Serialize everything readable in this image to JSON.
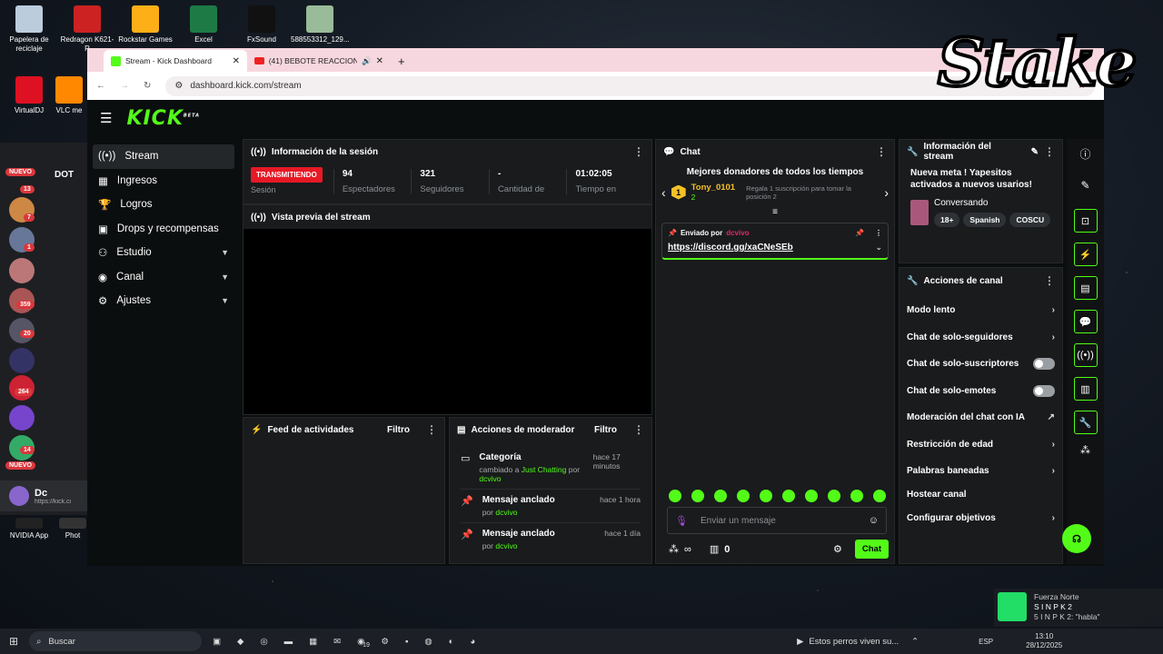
{
  "desktop": {
    "icons": [
      {
        "label": "Papelera de reciclaje"
      },
      {
        "label": "Redragon K621-R"
      },
      {
        "label": "Rockstar Games"
      },
      {
        "label": "Excel"
      },
      {
        "label": "FxSound"
      },
      {
        "label": "588553312_129..."
      },
      {
        "label": "VirtualDJ"
      },
      {
        "label": "VLC me"
      },
      {
        "label": "NVIDIA App"
      },
      {
        "label": "Phot"
      }
    ]
  },
  "overlay": {
    "stake_text": "Stake"
  },
  "browser": {
    "tabs": [
      {
        "title": "Stream - Kick Dashboard",
        "close": "✕"
      },
      {
        "title": "(41) BEBOTE REACCIONA A",
        "close": "✕"
      }
    ],
    "new_tab": "+",
    "url": "dashboard.kick.com/stream"
  },
  "kick": {
    "logo": "KICK",
    "logo_sup": "BETA",
    "nav": [
      {
        "label": "Stream",
        "icon": "stream-icon"
      },
      {
        "label": "Ingresos",
        "icon": "income-icon"
      },
      {
        "label": "Logros",
        "icon": "trophy-icon"
      },
      {
        "label": "Drops y recompensas",
        "icon": "gift-icon"
      },
      {
        "label": "Estudio",
        "icon": "studio-icon"
      },
      {
        "label": "Canal",
        "icon": "channel-icon"
      },
      {
        "label": "Ajustes",
        "icon": "gear-icon"
      }
    ],
    "session": {
      "title": "Información de la sesión",
      "status": "TRANSMITIENDO",
      "status_sub": "Sesión",
      "stats": [
        {
          "value": "94",
          "label": "Espectadores"
        },
        {
          "value": "321",
          "label": "Seguidores"
        },
        {
          "value": "-",
          "label": "Cantidad de"
        },
        {
          "value": "01:02:05",
          "label": "Tiempo en"
        }
      ]
    },
    "preview": {
      "title": "Vista previa del stream"
    },
    "feed": {
      "title": "Feed de actividades",
      "filter": "Filtro"
    },
    "mod": {
      "title": "Acciones de moderador",
      "filter": "Filtro",
      "items": [
        {
          "title": "Categoría",
          "sub_prefix": "cambiado a",
          "sub_highlight": "Just Chatting",
          "sub_mid": "por",
          "user": "dcvivo",
          "time": "hace 17 minutos"
        },
        {
          "title": "Mensaje anclado",
          "sub_prefix": "por",
          "user": "dcvivo",
          "time": "hace 1 hora"
        },
        {
          "title": "Mensaje anclado",
          "sub_prefix": "por",
          "user": "dcvivo",
          "time": "hace 1 día"
        }
      ]
    },
    "chat": {
      "title": "Chat",
      "donors_title": "Mejores donadores de todos los tiempos",
      "top_user": "Tony_0101",
      "top_rank": "1",
      "top_count": "2",
      "gift_note": "Regala 1 suscripción para tomar la posición 2",
      "pinned_label": "Enviado por",
      "pinned_user": "dcvivo",
      "pinned_link": "https://discord.gg/xaCNeSEb",
      "input_placeholder": "Enviar un mensaje",
      "points": "∞",
      "count": "0",
      "send": "Chat"
    },
    "stream_info": {
      "title": "Información del stream",
      "meta": "Nueva meta ! Yapesitos activados a nuevos usarios!",
      "category": "Conversando",
      "tags": [
        "18+",
        "Spanish",
        "COSCU"
      ]
    },
    "channel_actions": {
      "title": "Acciones de canal",
      "items": [
        {
          "label": "Modo lento",
          "ctrl": "arrow"
        },
        {
          "label": "Chat de solo-seguidores",
          "ctrl": "arrow"
        },
        {
          "label": "Chat de solo-suscriptores",
          "ctrl": "toggle"
        },
        {
          "label": "Chat de solo-emotes",
          "ctrl": "toggle"
        },
        {
          "label": "Moderación del chat con IA",
          "ctrl": "external"
        },
        {
          "label": "Restricción de edad",
          "ctrl": "arrow"
        },
        {
          "label": "Palabras baneadas",
          "ctrl": "arrow"
        },
        {
          "label": "Hostear canal",
          "ctrl": "none"
        },
        {
          "label": "Configurar objetivos",
          "ctrl": "arrow"
        }
      ]
    }
  },
  "discord": {
    "badges": [
      "NUEVO",
      "13",
      "7",
      "1",
      "359",
      "20",
      "264",
      "14",
      "NUEVO"
    ],
    "channel_prefix": "DOT",
    "user": "Dc",
    "user_sub": "https://kick.com"
  },
  "taskbar": {
    "search": "Buscar",
    "media": "Estos perros viven su...",
    "lang": "ESP",
    "time": "13:10",
    "date": "28/12/2025",
    "whatsapp_badge": "19"
  },
  "notification": {
    "title": "Fuerza Norte",
    "name": "S I N P K 2",
    "msg": "5 I N P K 2: \"habla\""
  }
}
